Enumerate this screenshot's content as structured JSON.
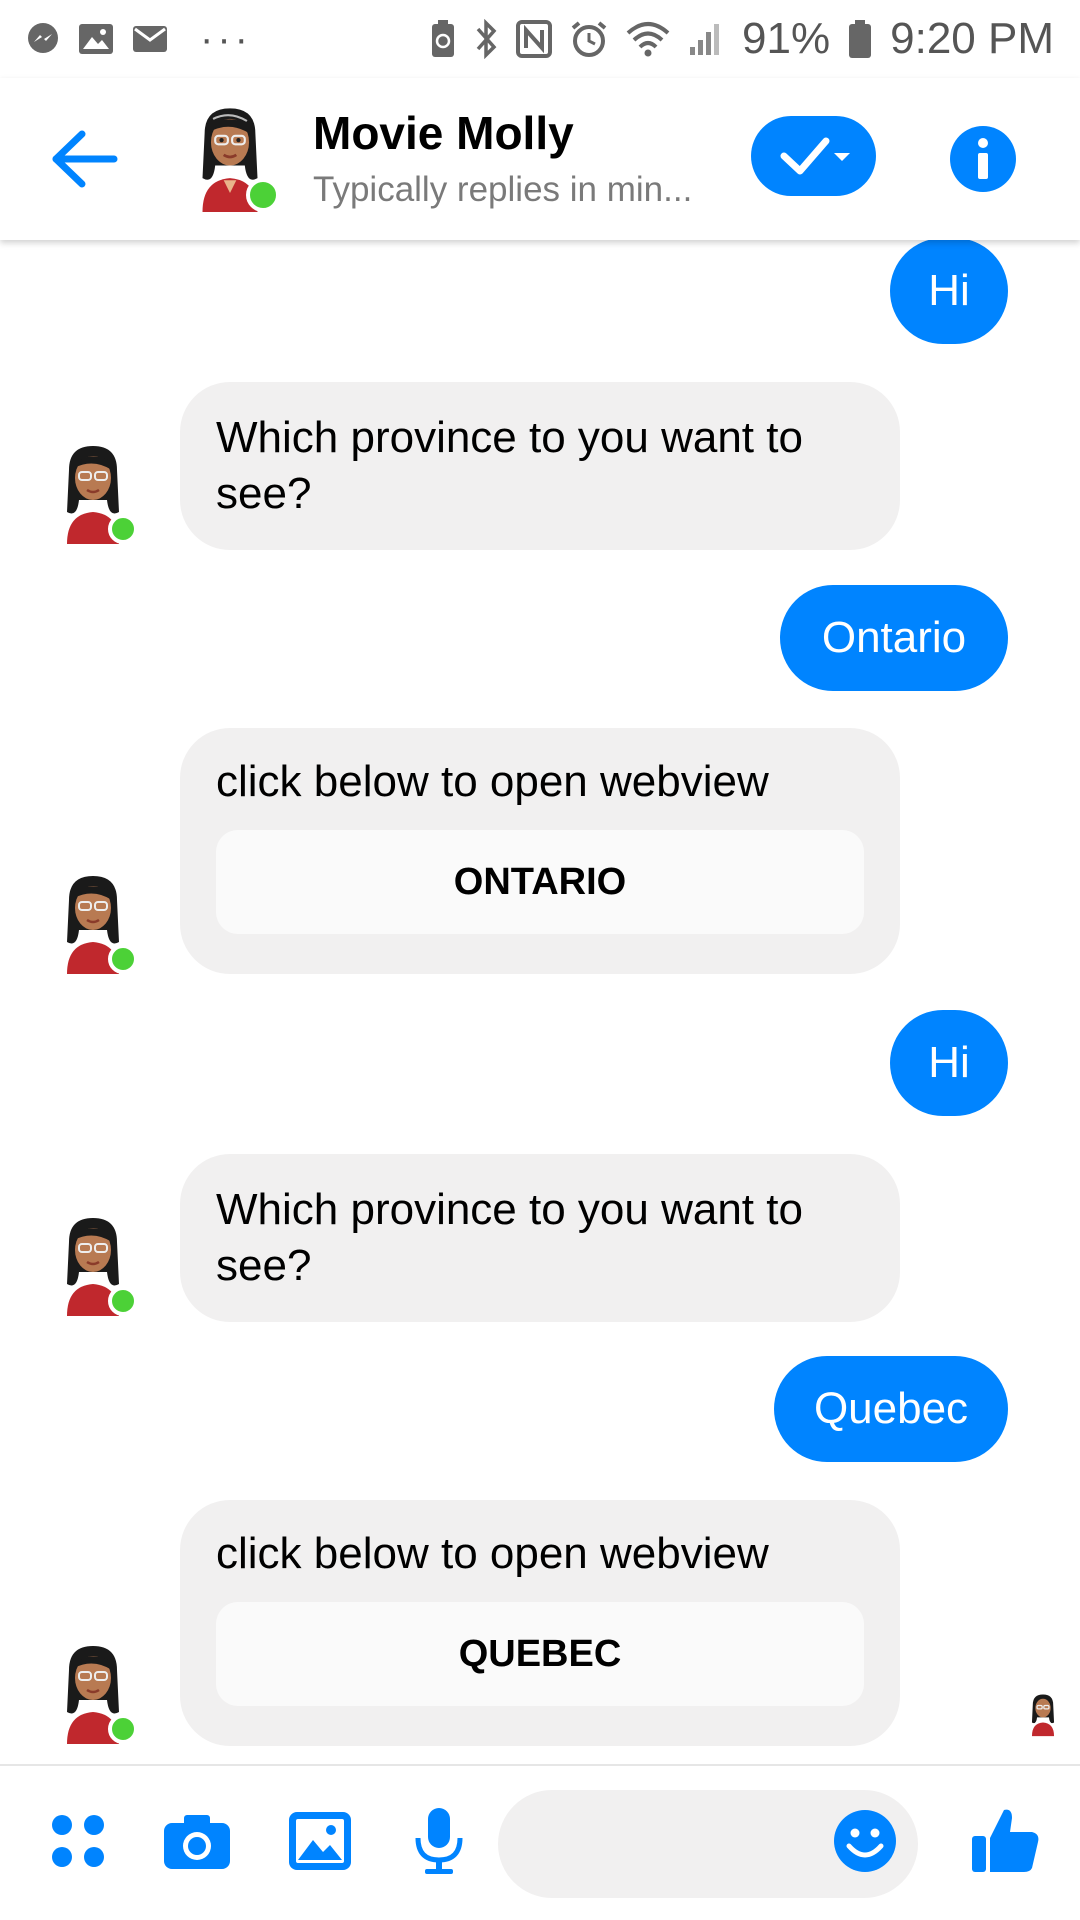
{
  "status_bar": {
    "left_icons": [
      "messenger-icon",
      "image-icon",
      "mail-icon",
      "more-dots-icon"
    ],
    "right_icons": [
      "battery-saver-icon",
      "bluetooth-icon",
      "nfc-icon",
      "alarm-icon",
      "wifi-icon",
      "signal-icon"
    ],
    "more_dots": "···",
    "battery_percent": "91%",
    "time": "9:20 PM"
  },
  "header": {
    "name": "Movie Molly",
    "subtitle": "Typically replies in min..."
  },
  "messages": [
    {
      "from": "me",
      "text": "Hi"
    },
    {
      "from": "bot",
      "text": "Which province to you want to see?"
    },
    {
      "from": "me",
      "text": "Ontario"
    },
    {
      "from": "bot",
      "text": "click below to open webview",
      "button": "ONTARIO"
    },
    {
      "from": "me",
      "text": "Hi"
    },
    {
      "from": "bot",
      "text": "Which province to you want to see?"
    },
    {
      "from": "me",
      "text": "Quebec"
    },
    {
      "from": "bot",
      "text": "click below to open webview",
      "button": "QUEBEC"
    }
  ],
  "composer": {
    "icons": [
      "apps-icon",
      "camera-icon",
      "photo-icon",
      "microphone-icon",
      "emoji-icon",
      "thumbs-up-icon"
    ]
  },
  "colors": {
    "accent": "#0084ff",
    "bubble_in": "#f1f0f0",
    "online": "#4cd137"
  }
}
